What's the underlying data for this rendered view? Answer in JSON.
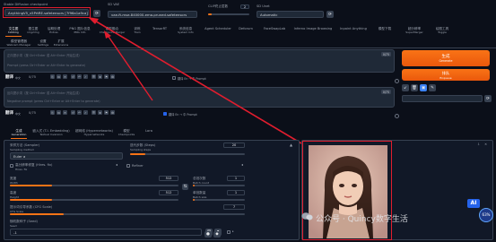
{
  "top": {
    "checkpoint_label": "Stable Diffusion checkpoint",
    "checkpoint_value": "AnythingV5_v5PrtRE.safetensors [7f96a1a9ca]",
    "vae_label": "SD VAE",
    "vae_value": "vae-ft-mse-840000-ema-pruned.safetensors",
    "clip_label": "CLIP终止层数",
    "clip_value": "2",
    "unet_label": "SD Unet",
    "unet_value": "Automatic"
  },
  "tabs_row1": [
    {
      "label": "文生图",
      "sub": "txt2img"
    },
    {
      "label": "图生图",
      "sub": "img2img"
    },
    {
      "label": "后期处理",
      "sub": "Extras"
    },
    {
      "label": "PNG 图片信息",
      "sub": "PNG Info"
    },
    {
      "label": "模型融合",
      "sub": "Checkpoint Merger"
    },
    {
      "label": "训练",
      "sub": "Train"
    },
    {
      "label": "TensorRT",
      "sub": ""
    },
    {
      "label": "系统信息",
      "sub": "System Info"
    },
    {
      "label": "Agent Scheduler",
      "sub": ""
    },
    {
      "label": "Deforum",
      "sub": ""
    },
    {
      "label": "FaceSwapLab",
      "sub": ""
    },
    {
      "label": "Inferno Image Browsing",
      "sub": ""
    },
    {
      "label": "Inpaint Anything",
      "sub": ""
    },
    {
      "label": "模型下载",
      "sub": ""
    },
    {
      "label": "超分辨率",
      "sub": "SuperMerger"
    },
    {
      "label": "绘图工具",
      "sub": "Toggle"
    }
  ],
  "tabs_row2": [
    {
      "label": "模型管理器",
      "sub": "Webcam Manager"
    },
    {
      "label": "设置",
      "sub": "Settings"
    },
    {
      "label": "扩展",
      "sub": "Extensions"
    }
  ],
  "prompt": {
    "counter": "0/75",
    "placeholder1": "正向提示词（按 Ctrl+Enter 或 Alt+Enter 开始生成）",
    "placeholder2": "Prompt (press Ctrl+Enter or Alt+Enter to generate)"
  },
  "neg_prompt": {
    "counter": "0/75",
    "placeholder1": "反向提示词（按 Ctrl+Enter 或 Alt+Enter 开始生成）",
    "placeholder2": "Negative prompt (press Ctrl+Enter or Alt+Enter to generate)"
  },
  "generate": {
    "label": "生成",
    "sub": "Generate"
  },
  "enqueue": {
    "label": "排队",
    "sub": "Enqueue"
  },
  "translate_label": "翻译",
  "translate_sub": "中文",
  "chk_label1": "翻译 En → 中 Prompt",
  "chk_label2": "翻译 En → 中 Prompt",
  "sub_tabs": [
    {
      "label": "生成",
      "sub": "Generation"
    },
    {
      "label": "嵌入式 (T.I. Embedding)",
      "sub": "Textual Inversion"
    },
    {
      "label": "超网络 (Hypernetworks)",
      "sub": "Hypernetworks"
    },
    {
      "label": "模型",
      "sub": "Checkpoints"
    },
    {
      "label": "Lora",
      "sub": ""
    }
  ],
  "sampler": {
    "label": "采样方法 (Sampler)",
    "sub": "Sampling method",
    "value": "Euler a"
  },
  "steps": {
    "label": "迭代步数 (Steps)",
    "sub": "Sampling steps",
    "value": "20",
    "fraction": 0.13
  },
  "hires": {
    "label": "高分辨率修复 (Hires. fix)",
    "sub": "Hires. fix"
  },
  "refiner": {
    "label": "Refiner"
  },
  "width": {
    "label": "宽度",
    "sub": "Width",
    "value": "512",
    "fraction": 0.25
  },
  "height": {
    "label": "高度",
    "sub": "Height",
    "value": "512",
    "fraction": 0.25
  },
  "batch_count": {
    "label": "总批次数",
    "sub": "Batch count",
    "value": "1"
  },
  "batch_size": {
    "label": "单批数量",
    "sub": "Batch size",
    "value": "1"
  },
  "cfg": {
    "label": "提示词引导系数 (CFG Scale)",
    "sub": "CFG Scale",
    "value": "7",
    "fraction": 0.23
  },
  "seed": {
    "label": "随机数种子 (Seed)",
    "sub": "Seed",
    "value": "-1"
  },
  "watermark": {
    "text": "公众号 · Quincy数字生活"
  },
  "badge": {
    "percent": "63%",
    "ai_label": "AI"
  },
  "colors": {
    "accent": "#f97316",
    "highlight": "#e11d2e"
  }
}
